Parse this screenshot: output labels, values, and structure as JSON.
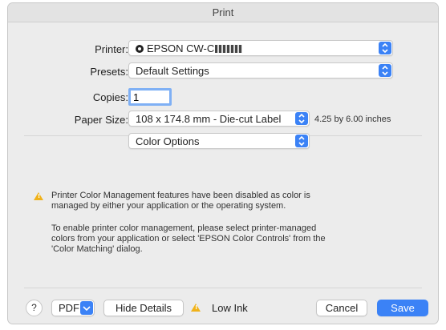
{
  "window": {
    "title": "Print"
  },
  "form": {
    "printer_label": "Printer:",
    "printer_value": "EPSON CW-C",
    "presets_label": "Presets:",
    "presets_value": "Default Settings",
    "copies_label": "Copies:",
    "copies_value": "1",
    "paper_size_label": "Paper Size:",
    "paper_size_value": "108 x 174.8 mm - Die-cut Label",
    "paper_size_dimensions": "4.25 by 6.00 inches",
    "section_value": "Color Options"
  },
  "messages": {
    "warning": "Printer Color Management features have been disabled as color is managed by either your application or the operating system.",
    "info": "To enable printer color management, please select printer-managed colors from your application or select 'EPSON Color Controls' from the 'Color Matching' dialog."
  },
  "footer": {
    "help_label": "?",
    "pdf_label": "PDF",
    "hide_details_label": "Hide Details",
    "low_ink_label": "Low Ink",
    "cancel_label": "Cancel",
    "save_label": "Save"
  },
  "colors": {
    "accent": "#3b82f6",
    "warning": "#f0b21a",
    "window_bg": "#ececec"
  },
  "icons": [
    "printer-status-icon",
    "popup-arrows-icon",
    "warning-icon",
    "pdf-dropdown-icon",
    "help-icon"
  ]
}
